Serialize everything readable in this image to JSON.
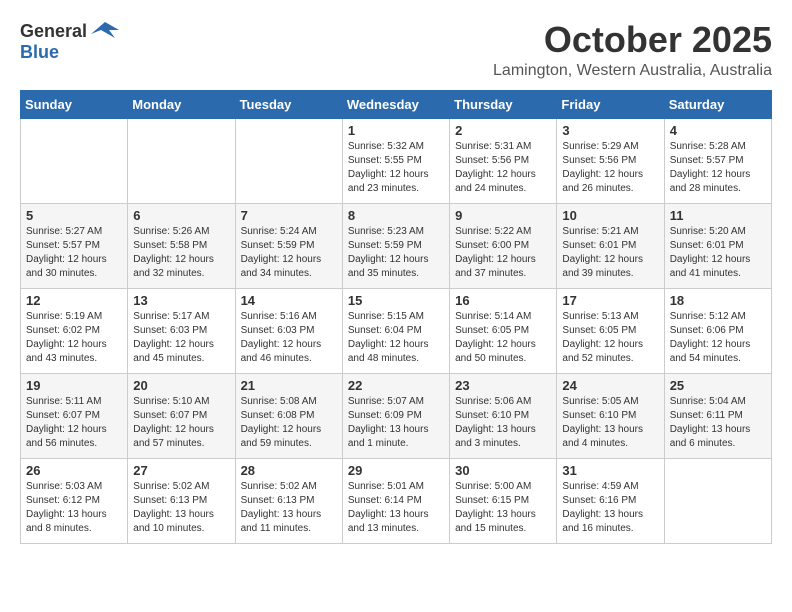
{
  "header": {
    "logo_general": "General",
    "logo_blue": "Blue",
    "month_title": "October 2025",
    "location": "Lamington, Western Australia, Australia"
  },
  "weekdays": [
    "Sunday",
    "Monday",
    "Tuesday",
    "Wednesday",
    "Thursday",
    "Friday",
    "Saturday"
  ],
  "weeks": [
    [
      {
        "day": "",
        "info": ""
      },
      {
        "day": "",
        "info": ""
      },
      {
        "day": "",
        "info": ""
      },
      {
        "day": "1",
        "info": "Sunrise: 5:32 AM\nSunset: 5:55 PM\nDaylight: 12 hours\nand 23 minutes."
      },
      {
        "day": "2",
        "info": "Sunrise: 5:31 AM\nSunset: 5:56 PM\nDaylight: 12 hours\nand 24 minutes."
      },
      {
        "day": "3",
        "info": "Sunrise: 5:29 AM\nSunset: 5:56 PM\nDaylight: 12 hours\nand 26 minutes."
      },
      {
        "day": "4",
        "info": "Sunrise: 5:28 AM\nSunset: 5:57 PM\nDaylight: 12 hours\nand 28 minutes."
      }
    ],
    [
      {
        "day": "5",
        "info": "Sunrise: 5:27 AM\nSunset: 5:57 PM\nDaylight: 12 hours\nand 30 minutes."
      },
      {
        "day": "6",
        "info": "Sunrise: 5:26 AM\nSunset: 5:58 PM\nDaylight: 12 hours\nand 32 minutes."
      },
      {
        "day": "7",
        "info": "Sunrise: 5:24 AM\nSunset: 5:59 PM\nDaylight: 12 hours\nand 34 minutes."
      },
      {
        "day": "8",
        "info": "Sunrise: 5:23 AM\nSunset: 5:59 PM\nDaylight: 12 hours\nand 35 minutes."
      },
      {
        "day": "9",
        "info": "Sunrise: 5:22 AM\nSunset: 6:00 PM\nDaylight: 12 hours\nand 37 minutes."
      },
      {
        "day": "10",
        "info": "Sunrise: 5:21 AM\nSunset: 6:01 PM\nDaylight: 12 hours\nand 39 minutes."
      },
      {
        "day": "11",
        "info": "Sunrise: 5:20 AM\nSunset: 6:01 PM\nDaylight: 12 hours\nand 41 minutes."
      }
    ],
    [
      {
        "day": "12",
        "info": "Sunrise: 5:19 AM\nSunset: 6:02 PM\nDaylight: 12 hours\nand 43 minutes."
      },
      {
        "day": "13",
        "info": "Sunrise: 5:17 AM\nSunset: 6:03 PM\nDaylight: 12 hours\nand 45 minutes."
      },
      {
        "day": "14",
        "info": "Sunrise: 5:16 AM\nSunset: 6:03 PM\nDaylight: 12 hours\nand 46 minutes."
      },
      {
        "day": "15",
        "info": "Sunrise: 5:15 AM\nSunset: 6:04 PM\nDaylight: 12 hours\nand 48 minutes."
      },
      {
        "day": "16",
        "info": "Sunrise: 5:14 AM\nSunset: 6:05 PM\nDaylight: 12 hours\nand 50 minutes."
      },
      {
        "day": "17",
        "info": "Sunrise: 5:13 AM\nSunset: 6:05 PM\nDaylight: 12 hours\nand 52 minutes."
      },
      {
        "day": "18",
        "info": "Sunrise: 5:12 AM\nSunset: 6:06 PM\nDaylight: 12 hours\nand 54 minutes."
      }
    ],
    [
      {
        "day": "19",
        "info": "Sunrise: 5:11 AM\nSunset: 6:07 PM\nDaylight: 12 hours\nand 56 minutes."
      },
      {
        "day": "20",
        "info": "Sunrise: 5:10 AM\nSunset: 6:07 PM\nDaylight: 12 hours\nand 57 minutes."
      },
      {
        "day": "21",
        "info": "Sunrise: 5:08 AM\nSunset: 6:08 PM\nDaylight: 12 hours\nand 59 minutes."
      },
      {
        "day": "22",
        "info": "Sunrise: 5:07 AM\nSunset: 6:09 PM\nDaylight: 13 hours\nand 1 minute."
      },
      {
        "day": "23",
        "info": "Sunrise: 5:06 AM\nSunset: 6:10 PM\nDaylight: 13 hours\nand 3 minutes."
      },
      {
        "day": "24",
        "info": "Sunrise: 5:05 AM\nSunset: 6:10 PM\nDaylight: 13 hours\nand 4 minutes."
      },
      {
        "day": "25",
        "info": "Sunrise: 5:04 AM\nSunset: 6:11 PM\nDaylight: 13 hours\nand 6 minutes."
      }
    ],
    [
      {
        "day": "26",
        "info": "Sunrise: 5:03 AM\nSunset: 6:12 PM\nDaylight: 13 hours\nand 8 minutes."
      },
      {
        "day": "27",
        "info": "Sunrise: 5:02 AM\nSunset: 6:13 PM\nDaylight: 13 hours\nand 10 minutes."
      },
      {
        "day": "28",
        "info": "Sunrise: 5:02 AM\nSunset: 6:13 PM\nDaylight: 13 hours\nand 11 minutes."
      },
      {
        "day": "29",
        "info": "Sunrise: 5:01 AM\nSunset: 6:14 PM\nDaylight: 13 hours\nand 13 minutes."
      },
      {
        "day": "30",
        "info": "Sunrise: 5:00 AM\nSunset: 6:15 PM\nDaylight: 13 hours\nand 15 minutes."
      },
      {
        "day": "31",
        "info": "Sunrise: 4:59 AM\nSunset: 6:16 PM\nDaylight: 13 hours\nand 16 minutes."
      },
      {
        "day": "",
        "info": ""
      }
    ]
  ]
}
